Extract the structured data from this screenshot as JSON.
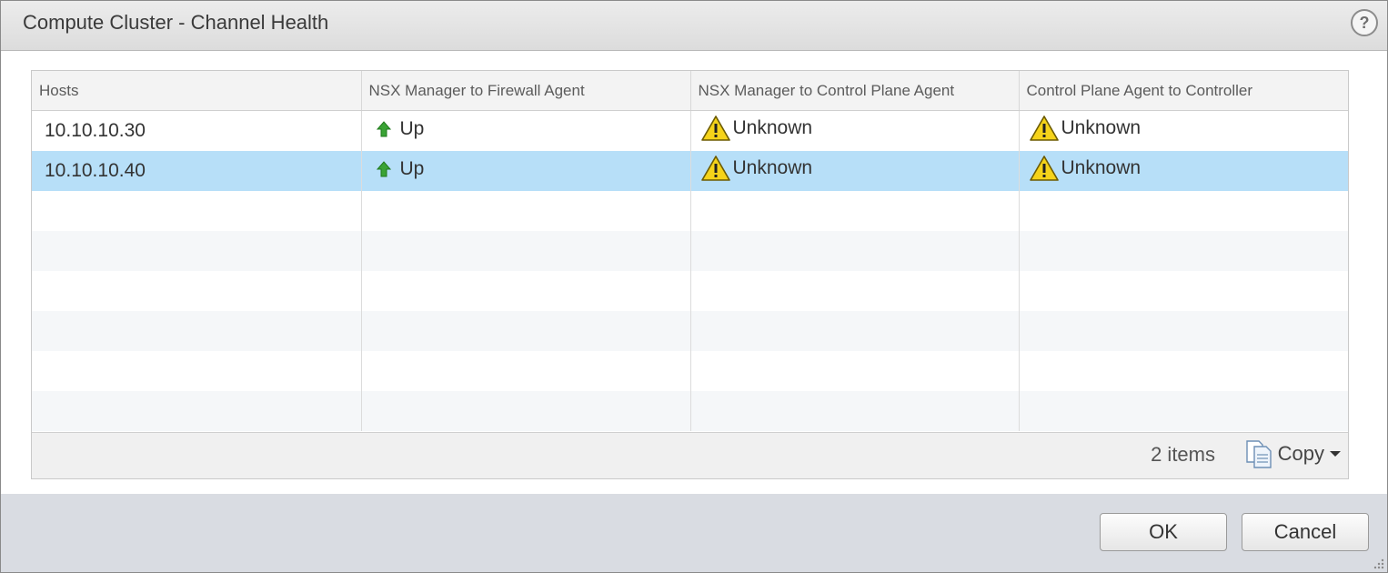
{
  "dialog": {
    "title": "Compute Cluster - Channel Health",
    "help_label": "?"
  },
  "table": {
    "columns": [
      "Hosts",
      "NSX Manager to Firewall Agent",
      "NSX Manager to Control Plane Agent",
      "Control Plane Agent to Controller"
    ],
    "rows": [
      {
        "host": "10.10.10.30",
        "firewall": {
          "status": "Up",
          "icon": "up-arrow-icon"
        },
        "control_plane": {
          "status": "Unknown",
          "icon": "warning-icon"
        },
        "controller": {
          "status": "Unknown",
          "icon": "warning-icon"
        }
      },
      {
        "host": "10.10.10.40",
        "firewall": {
          "status": "Up",
          "icon": "up-arrow-icon"
        },
        "control_plane": {
          "status": "Unknown",
          "icon": "warning-icon"
        },
        "controller": {
          "status": "Unknown",
          "icon": "warning-icon"
        }
      }
    ],
    "selected_row": 1
  },
  "footer": {
    "item_count": "2 items",
    "copy_label": "Copy"
  },
  "buttons": {
    "ok": "OK",
    "cancel": "Cancel"
  },
  "colors": {
    "selected_row": "#b7dff8",
    "up_green": "#3aa335",
    "warning_yellow": "#f5d31a"
  }
}
